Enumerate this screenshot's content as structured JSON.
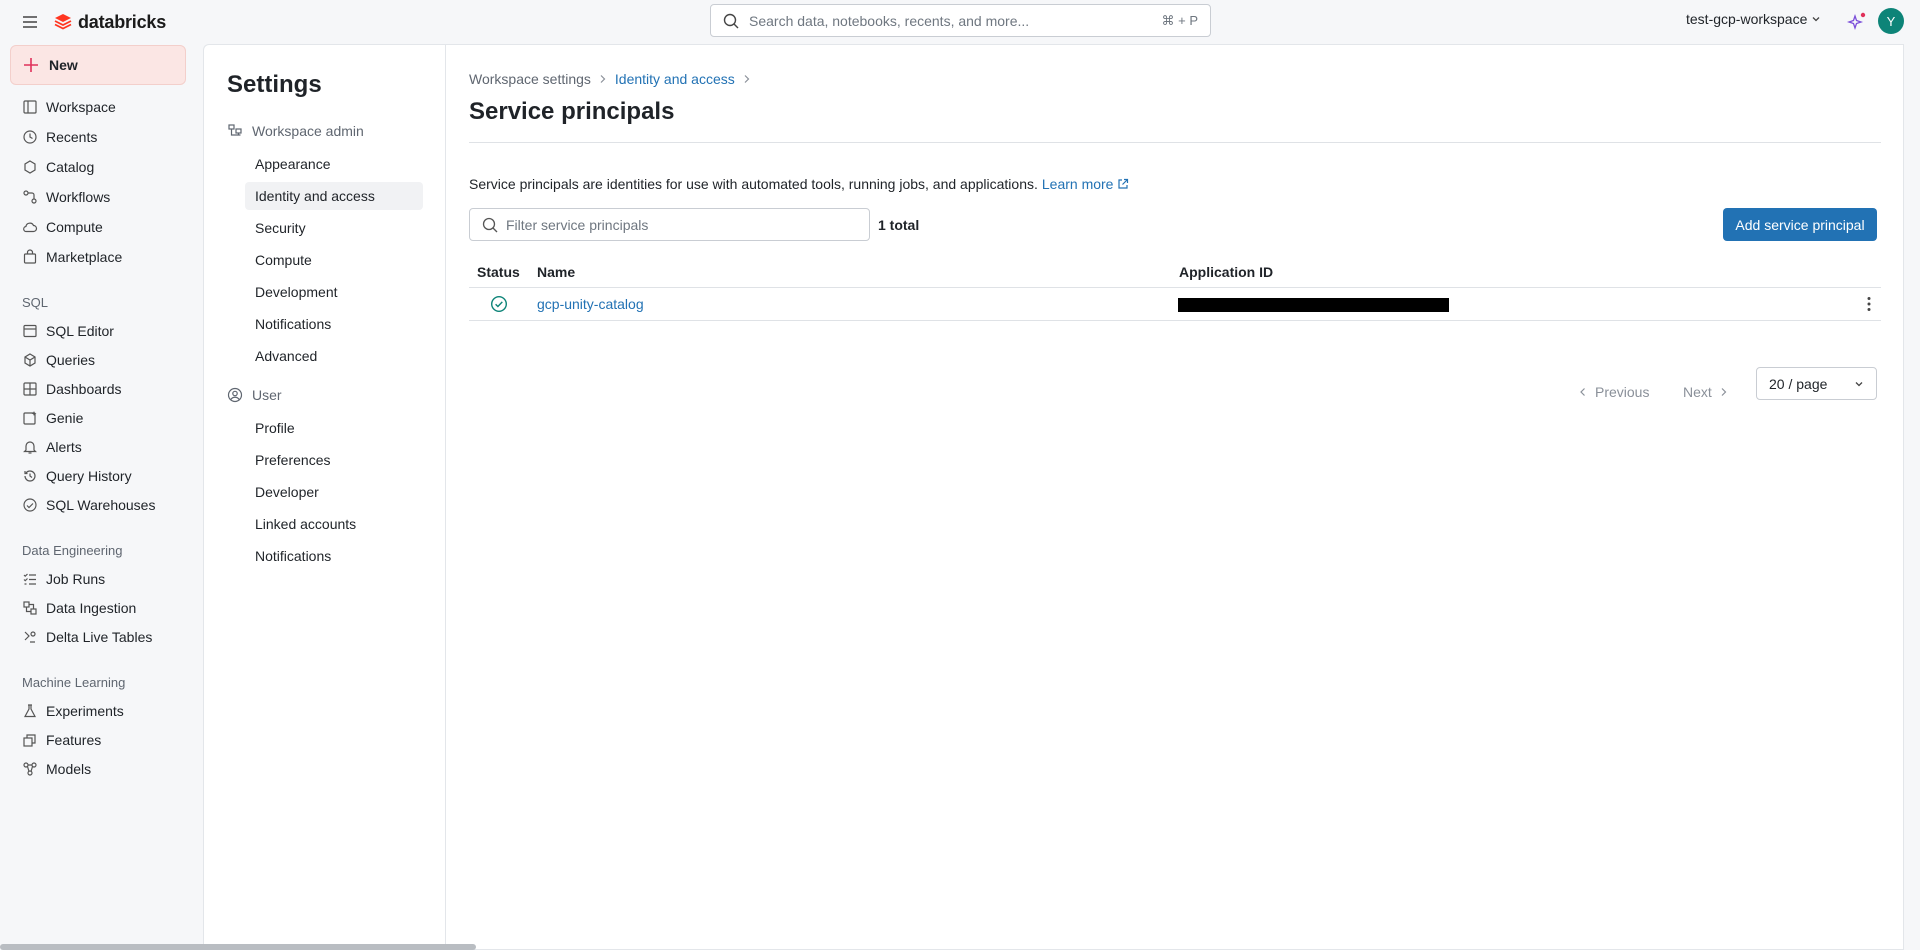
{
  "topbar": {
    "brand": "databricks",
    "search_placeholder": "Search data, notebooks, recents, and more...",
    "search_shortcut": "⌘ + P",
    "workspace": "test-gcp-workspace",
    "avatar_initial": "Y"
  },
  "leftnav": {
    "new_label": "New",
    "items": [
      {
        "label": "Workspace",
        "icon": "workspace-icon"
      },
      {
        "label": "Recents",
        "icon": "clock-icon"
      },
      {
        "label": "Catalog",
        "icon": "catalog-icon"
      },
      {
        "label": "Workflows",
        "icon": "workflows-icon"
      },
      {
        "label": "Compute",
        "icon": "cloud-icon"
      },
      {
        "label": "Marketplace",
        "icon": "marketplace-icon"
      }
    ],
    "sql_section": "SQL",
    "sql_items": [
      {
        "label": "SQL Editor",
        "icon": "sql-editor-icon"
      },
      {
        "label": "Queries",
        "icon": "queries-icon"
      },
      {
        "label": "Dashboards",
        "icon": "dashboards-icon"
      },
      {
        "label": "Genie",
        "icon": "genie-icon"
      },
      {
        "label": "Alerts",
        "icon": "bell-icon"
      },
      {
        "label": "Query History",
        "icon": "history-icon"
      },
      {
        "label": "SQL Warehouses",
        "icon": "warehouse-icon"
      }
    ],
    "de_section": "Data Engineering",
    "de_items": [
      {
        "label": "Job Runs",
        "icon": "job-runs-icon"
      },
      {
        "label": "Data Ingestion",
        "icon": "ingestion-icon"
      },
      {
        "label": "Delta Live Tables",
        "icon": "delta-icon"
      }
    ],
    "ml_section": "Machine Learning",
    "ml_items": [
      {
        "label": "Experiments",
        "icon": "flask-icon"
      },
      {
        "label": "Features",
        "icon": "features-icon"
      },
      {
        "label": "Models",
        "icon": "models-icon"
      }
    ]
  },
  "settings": {
    "title": "Settings",
    "admin_group": "Workspace admin",
    "admin_items": [
      "Appearance",
      "Identity and access",
      "Security",
      "Compute",
      "Development",
      "Notifications",
      "Advanced"
    ],
    "user_group": "User",
    "user_items": [
      "Profile",
      "Preferences",
      "Developer",
      "Linked accounts",
      "Notifications"
    ]
  },
  "main": {
    "breadcrumb": [
      "Workspace settings",
      "Identity and access"
    ],
    "title": "Service principals",
    "description": "Service principals are identities for use with automated tools, running jobs, and applications.",
    "learn_more": "Learn more",
    "filter_placeholder": "Filter service principals",
    "total": "1 total",
    "add_button": "Add service principal",
    "columns": [
      "Status",
      "Name",
      "Application ID"
    ],
    "rows": [
      {
        "status": "active",
        "name": "gcp-unity-catalog",
        "application_id": ""
      }
    ],
    "pager": {
      "previous": "Previous",
      "next": "Next",
      "page_size": "20 / page"
    }
  },
  "colors": {
    "accent": "#2272b4",
    "new_bg": "#fbe6e4",
    "avatar": "#0d8478",
    "status_ok": "#0d8478"
  }
}
